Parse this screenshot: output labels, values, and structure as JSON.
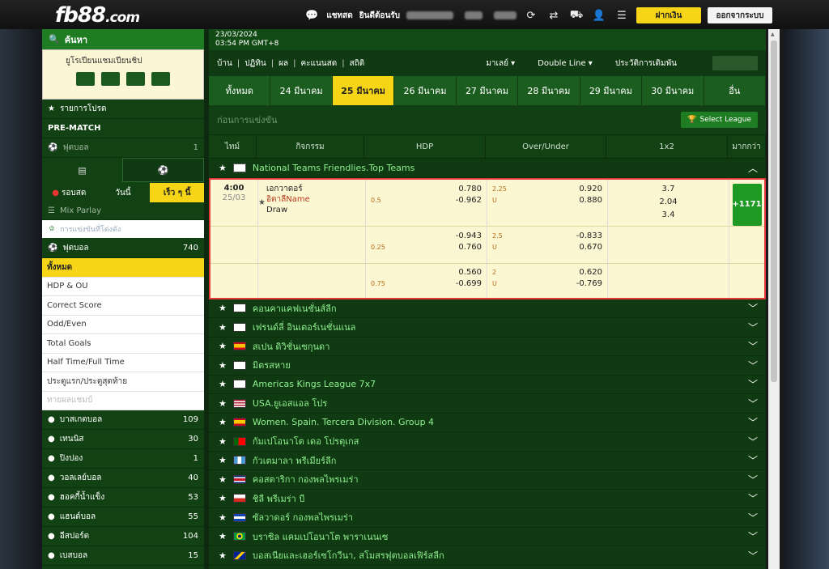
{
  "header": {
    "logo_main": "fb88",
    "logo_tld": ".com",
    "chat": "แชทสด",
    "welcome": "ยินดีต้อนรับ",
    "deposit": "ฝากเงิน",
    "logout": "ออกจากระบบ"
  },
  "sidebar": {
    "search": "ค้นหา",
    "promo_title": "ยูโรเปียนแชมเปียนชิป",
    "favorites": "รายการโปรด",
    "prematch": "PRE-MATCH",
    "prematch_football": "ฟุตบอล",
    "prematch_count": "1",
    "tabs": [
      "รอบสด",
      "วันนี้",
      "เร็ว ๆ นี้"
    ],
    "mix_parlay": "Mix Parlay",
    "search_placeholder": "การแข่งขันที่โด่งดัง",
    "football": "ฟุตบอล",
    "football_count": "740",
    "submenu": [
      "ทั้งหมด",
      "HDP & OU",
      "Correct Score",
      "Odd/Even",
      "Total Goals",
      "Half Time/Full Time",
      "ประตูแรก/ประตูสุดท้าย",
      "ทายผลแชมป์"
    ],
    "sports": [
      {
        "name": "บาสเกตบอล",
        "count": "109"
      },
      {
        "name": "เทนนิส",
        "count": "30"
      },
      {
        "name": "ปิงปอง",
        "count": "1"
      },
      {
        "name": "วอลเลย์บอล",
        "count": "40"
      },
      {
        "name": "ฮอคกี้น้ำแข็ง",
        "count": "53"
      },
      {
        "name": "แฮนด์บอล",
        "count": "55"
      },
      {
        "name": "อีสปอร์ต",
        "count": "104"
      },
      {
        "name": "เบสบอล",
        "count": "15"
      }
    ]
  },
  "main": {
    "date": "23/03/2024",
    "time": "03:54 PM GMT+8",
    "nav": [
      "บ้าน",
      "ปฏิทิน",
      "ผล",
      "คะแนนสด",
      "สถิติ"
    ],
    "nav_right": [
      "มาเลย์",
      "Double Line",
      "ประวัติการเดิมพัน"
    ],
    "date_tabs": [
      "ทั้งหมด",
      "24 มีนาคม",
      "25 มีนาคม",
      "26 มีนาคม",
      "27 มีนาคม",
      "28 มีนาคม",
      "29 มีนาคม",
      "30 มีนาคม",
      "อื่น"
    ],
    "section_title": "ก่อนการแข่งขัน",
    "select_league": "Select League",
    "columns": [
      "ไทม์",
      "กิจกรรม",
      "HDP",
      "Over/Under",
      "1x2",
      "มากกว่า"
    ],
    "first_league": "National Teams Friendlies.Top Teams",
    "match": {
      "time": "4:00",
      "date": "25/03",
      "home": "เอกวาดอร์",
      "away": "อิตาลีName",
      "draw": "Draw",
      "more": "+1171",
      "rows": [
        {
          "hdp_line": "0.5",
          "hdp_home": "0.780",
          "hdp_away": "-0.962",
          "ou_line": "2.25",
          "ou_u": "U",
          "ou_over": "0.920",
          "ou_under": "0.880",
          "x1": "3.7",
          "x2": "2.04",
          "xx": "3.4"
        },
        {
          "hdp_line": "0.25",
          "hdp_home": "-0.943",
          "hdp_away": "0.760",
          "ou_line": "2.5",
          "ou_u": "U",
          "ou_over": "-0.833",
          "ou_under": "0.670"
        },
        {
          "hdp_line": "0.75",
          "hdp_home": "0.560",
          "hdp_away": "-0.699",
          "ou_line": "2",
          "ou_u": "U",
          "ou_over": "0.620",
          "ou_under": "-0.769"
        }
      ]
    },
    "leagues": [
      {
        "name": "คอนคาแคฟเนชั่นส์ลีก",
        "flag": "generic"
      },
      {
        "name": "เฟรนด์ลี่ อินเตอร์เนชั่นแนล",
        "flag": "generic"
      },
      {
        "name": "สเปน ดิวิชั่นเซกุนดา",
        "flag": "spain"
      },
      {
        "name": "มิตรสหาย",
        "flag": "generic"
      },
      {
        "name": "Americas Kings League 7x7",
        "flag": "generic"
      },
      {
        "name": "USA.ยูเอสแอล โปร",
        "flag": "usa"
      },
      {
        "name": "Women. Spain. Tercera Division. Group 4",
        "flag": "spain"
      },
      {
        "name": "กัมเปโอนาโต เดอ โปรตุเกส",
        "flag": "portugal"
      },
      {
        "name": "กัวเตมาลา พรีเมียร์ลีก",
        "flag": "guatemala"
      },
      {
        "name": "คอสตาริกา กองพลไพรเมร่า",
        "flag": "costarica"
      },
      {
        "name": "ชิลี พรีเมร่า บี",
        "flag": "chile"
      },
      {
        "name": "ซัลวาดอร์ กองพลไพรเมร่า",
        "flag": "salvador"
      },
      {
        "name": "บราซิล แคมเปโอนาโต พาราเนนเซ",
        "flag": "brazil"
      },
      {
        "name": "บอสเนียและเฮอร์เซโกวีนา, สโมสรฟุตบอลเฟิร์สลีก",
        "flag": "bosnia"
      }
    ]
  }
}
